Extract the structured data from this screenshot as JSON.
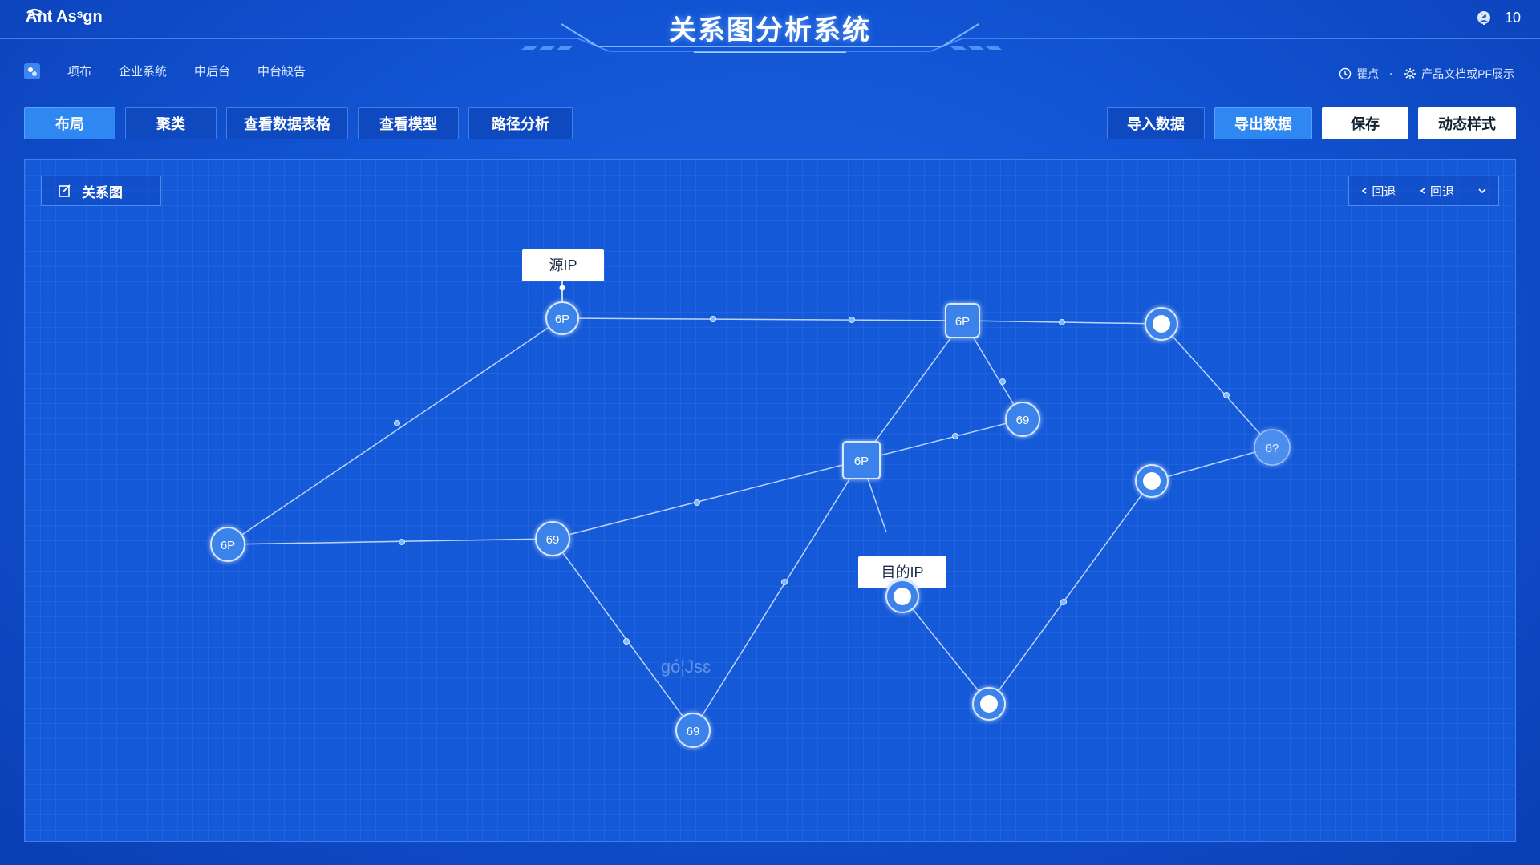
{
  "header": {
    "brand": "Ant Asˢgn",
    "title": "关系图分析系统",
    "count": "10"
  },
  "subnav": {
    "items": [
      "项布",
      "企业系统",
      "中后台",
      "中台缺告"
    ],
    "right_items": [
      "瞿点",
      "产品文档或PF展示"
    ]
  },
  "toolbar": {
    "left": [
      "布局",
      "聚类",
      "查看数据表格",
      "查看模型",
      "路径分析"
    ],
    "right": [
      "导入数据",
      "导出数据",
      "保存",
      "动态样式"
    ]
  },
  "panel": {
    "tab_label": "关系图",
    "nav_back": "回退",
    "nav_back2": "回退"
  },
  "graph": {
    "source_label": "源IP",
    "dest_label": "目的IP",
    "watermark": "gó¦Jsɛ",
    "node_labels": {
      "n1": "6P",
      "n2": "6P",
      "n3": "6P",
      "n4": "69",
      "n5": "6P",
      "n6": "69",
      "n7": "69",
      "n8": "6P",
      "n9": "6?"
    }
  },
  "colors": {
    "accent": "#2f87f2",
    "background": "#1459d8",
    "node": "#3a83ea"
  }
}
